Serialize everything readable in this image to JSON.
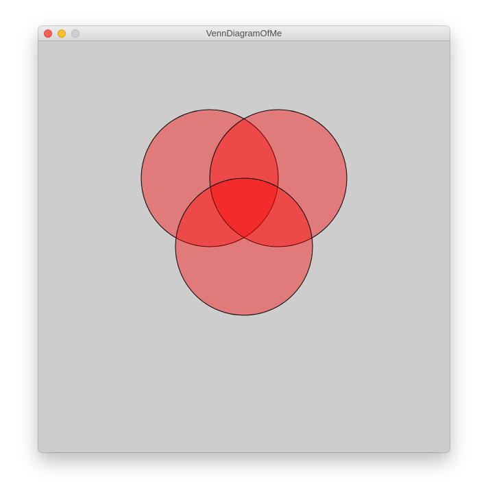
{
  "window": {
    "title": "VennDiagramOfMe",
    "buttons": [
      "close",
      "minimize",
      "zoom"
    ]
  },
  "canvas": {
    "background": "#cdcdcd",
    "circle_fill": "#ff0000",
    "circle_fill_opacity": 0.4,
    "circle_stroke": "#000000",
    "circles": [
      "top-left-circle",
      "top-right-circle",
      "bottom-circle"
    ]
  }
}
